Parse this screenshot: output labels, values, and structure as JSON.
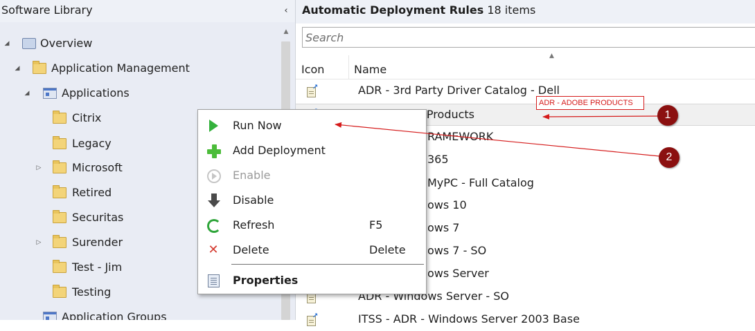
{
  "left": {
    "title": "Software Library",
    "collapse_glyph": "‹",
    "tree": [
      {
        "label": "Overview",
        "icon": "overview-icon",
        "expander": "◢"
      },
      {
        "label": "Application Management",
        "icon": "folder-icon",
        "expander": "◢"
      },
      {
        "label": "Applications",
        "icon": "applications-icon",
        "expander": "◢"
      },
      {
        "label": "Citrix",
        "icon": "folder-icon",
        "expander": ""
      },
      {
        "label": "Legacy",
        "icon": "folder-icon",
        "expander": ""
      },
      {
        "label": "Microsoft",
        "icon": "folder-icon",
        "expander": "▷"
      },
      {
        "label": "Retired",
        "icon": "folder-icon",
        "expander": ""
      },
      {
        "label": "Securitas",
        "icon": "folder-icon",
        "expander": ""
      },
      {
        "label": "Surender",
        "icon": "folder-icon",
        "expander": "▷"
      },
      {
        "label": "Test - Jim",
        "icon": "folder-icon",
        "expander": ""
      },
      {
        "label": "Testing",
        "icon": "folder-icon",
        "expander": ""
      },
      {
        "label": "Application Groups",
        "icon": "applications-icon",
        "expander": ""
      }
    ]
  },
  "right": {
    "title": "Automatic Deployment Rules",
    "count": "18 items",
    "search_placeholder": "Search",
    "columns": {
      "icon": "Icon",
      "name": "Name"
    },
    "sort_glyph": "▲",
    "rows": [
      "ADR - 3rd Party Driver Catalog - Dell",
      "e Products",
      "RAMEWORK",
      "365",
      "MyPC - Full Catalog",
      "ows 10",
      "ows 7",
      "ows 7 - SO",
      "ows Server",
      "ADR - Windows Server - SO",
      "ITSS - ADR - Windows Server 2003 Base"
    ]
  },
  "context_menu": {
    "items": [
      {
        "label": "Run Now",
        "shortcut": "",
        "icon": "run-now-icon",
        "disabled": false,
        "bold": false
      },
      {
        "label": "Add Deployment",
        "shortcut": "",
        "icon": "add-icon",
        "disabled": false,
        "bold": false
      },
      {
        "label": "Enable",
        "shortcut": "",
        "icon": "enable-icon",
        "disabled": true,
        "bold": false
      },
      {
        "label": "Disable",
        "shortcut": "",
        "icon": "disable-icon",
        "disabled": false,
        "bold": false
      },
      {
        "label": "Refresh",
        "shortcut": "F5",
        "icon": "refresh-icon",
        "disabled": false,
        "bold": false
      },
      {
        "label": "Delete",
        "shortcut": "Delete",
        "icon": "delete-icon",
        "disabled": false,
        "bold": false
      },
      {
        "label": "Properties",
        "shortcut": "",
        "icon": "properties-icon",
        "disabled": false,
        "bold": true
      }
    ]
  },
  "annotations": {
    "callout": "ADR - ADOBE PRODUCTS",
    "badge1": "1",
    "badge2": "2",
    "color": "#d51b1b",
    "badge_color": "#8b1010"
  }
}
